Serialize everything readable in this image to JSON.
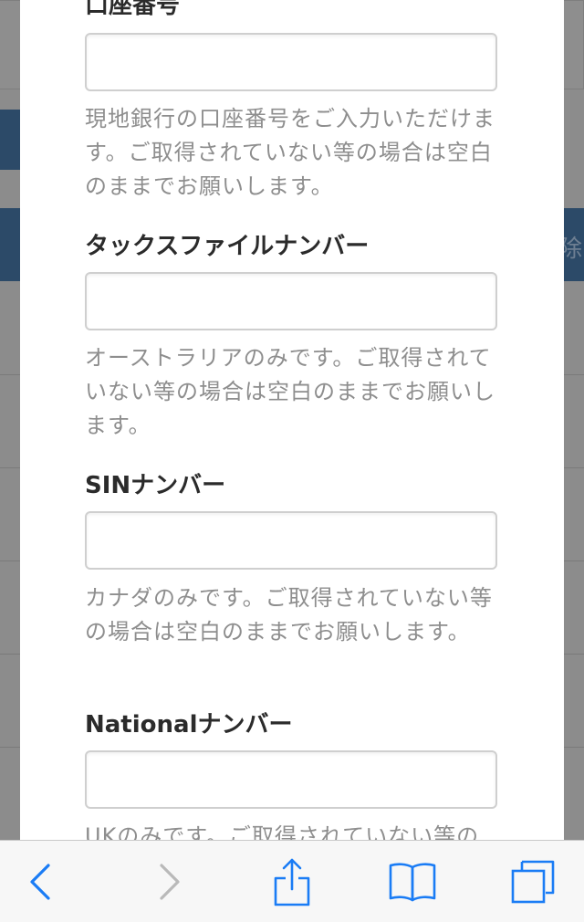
{
  "modal": {
    "fields": [
      {
        "label": "口座番号",
        "value": "",
        "help": "現地銀行の口座番号をご入力いただけます。ご取得されていない等の場合は空白のままでお願いします。"
      },
      {
        "label": "タックスファイルナンバー",
        "value": "",
        "help": "オーストラリアのみです。ご取得されていない等の場合は空白のままでお願いします。"
      },
      {
        "label": "SINナンバー",
        "value": "",
        "help": "カナダのみです。ご取得されていない等の場合は空白のままでお願いします。"
      },
      {
        "label": "Nationalナンバー",
        "value": "",
        "help": "UKのみです。ご取得されていない等の"
      }
    ]
  },
  "background": {
    "fragment_text": "除"
  },
  "toolbar": {
    "back_icon": "chevron-left-icon",
    "forward_icon": "chevron-right-icon",
    "share_icon": "share-icon",
    "bookmarks_icon": "book-icon",
    "tabs_icon": "tabs-icon",
    "accent_color": "#1a7cf5",
    "disabled_color": "#b9b9b9"
  }
}
